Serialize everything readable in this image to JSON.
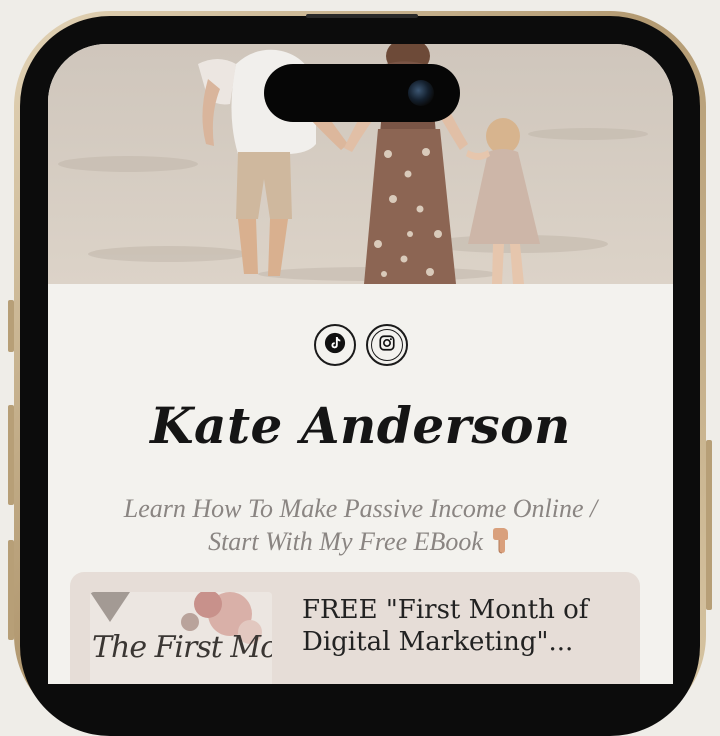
{
  "profile": {
    "name": "Kate Anderson",
    "bio_line1": "Learn How To Make Passive Income Online /",
    "bio_line2": "Start With My Free EBook"
  },
  "socials": [
    {
      "label": "TikTok",
      "icon": "tiktok-icon"
    },
    {
      "label": "Instagram",
      "icon": "instagram-icon"
    }
  ],
  "links": [
    {
      "title": "FREE \"First Month of Digital Marketing\"...",
      "thumbnail_text": "The First Month",
      "thumbnail_icon": "ebook-cover-image"
    }
  ],
  "colors": {
    "page_background": "#efede8",
    "screen_background": "#f3f2ee",
    "card_background": "#e6ddd7",
    "name_text": "#151515",
    "bio_text": "#8a8582",
    "phone_frame": "#c8b38e"
  },
  "icons": [
    "tiktok-icon",
    "instagram-icon",
    "pointing-down-icon",
    "camera-lens-icon"
  ]
}
